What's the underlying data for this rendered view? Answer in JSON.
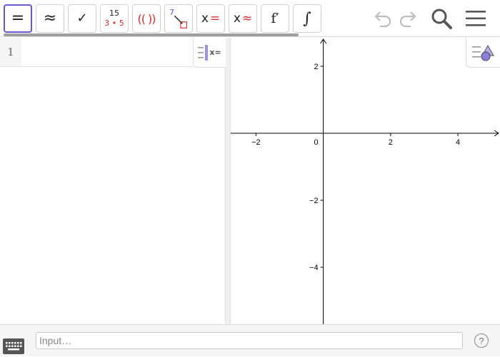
{
  "toolbar": {
    "tools": [
      {
        "name": "tool-evaluate",
        "glyph": "="
      },
      {
        "name": "tool-numeric",
        "glyph": "≈"
      },
      {
        "name": "tool-keep-input",
        "glyph": "✓"
      },
      {
        "name": "tool-factor",
        "top": "15",
        "bottom": "3 • 5"
      },
      {
        "name": "tool-expand",
        "glyph": "(( ))"
      },
      {
        "name": "tool-substitute",
        "glyph": "7"
      },
      {
        "name": "tool-solve",
        "x": "x",
        "sym": "="
      },
      {
        "name": "tool-solve-numeric",
        "x": "x",
        "sym": "≈"
      },
      {
        "name": "tool-derivative",
        "glyph": "f′"
      },
      {
        "name": "tool-integral",
        "glyph": "∫"
      }
    ]
  },
  "algebra": {
    "row_number": "1",
    "menu_label": "x="
  },
  "graphics": {
    "x_ticks": [
      -2,
      2,
      4
    ],
    "y_ticks": [
      2,
      -2,
      -4
    ],
    "origin_label": "0",
    "x_range": [
      -2.75,
      5.25
    ],
    "y_range": [
      -5.7,
      2.85
    ]
  },
  "inputbar": {
    "placeholder": "Input…",
    "help": "?"
  },
  "colors": {
    "accent": "#6557d2",
    "red": "#d32f2f",
    "icon": "#999999"
  }
}
